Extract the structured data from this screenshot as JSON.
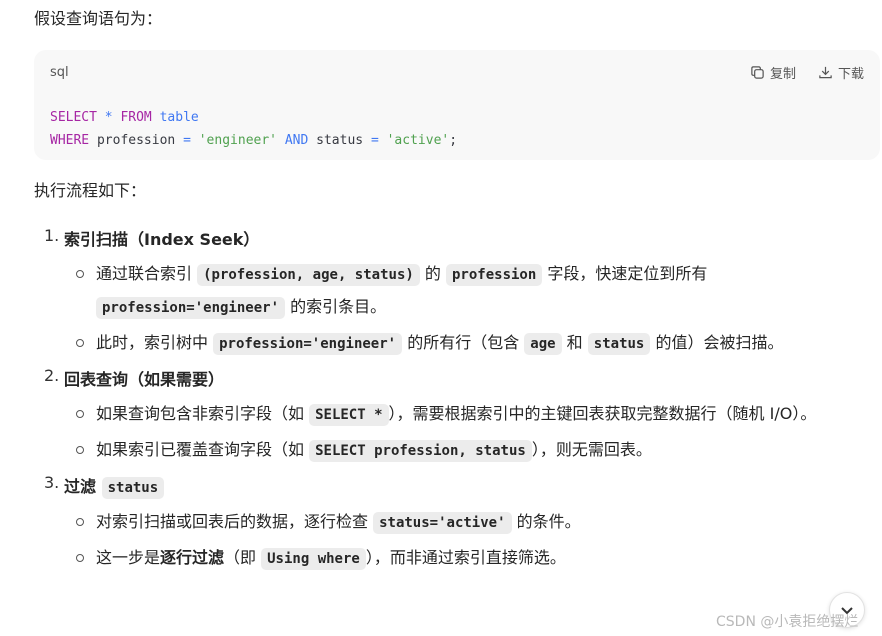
{
  "intro": "假设查询语句为：",
  "code_block": {
    "lang": "sql",
    "copy_label": "复制",
    "download_label": "下载",
    "line1": {
      "kw1": "SELECT",
      "op": "*",
      "kw2": "FROM",
      "tbl": "table"
    },
    "line2": {
      "kw1": "WHERE",
      "col1": "profession",
      "eq1": "=",
      "v1": "'engineer'",
      "kw2": "AND",
      "col2": "status",
      "eq2": "=",
      "v2": "'active'",
      "end": ";"
    }
  },
  "flow_title": "执行流程如下：",
  "steps": [
    {
      "num": "1.",
      "title": "索引扫描（Index Seek）",
      "items": [
        {
          "t1": "通过联合索引 ",
          "c1": "(profession, age, status)",
          "t2": " 的 ",
          "c2": "profession",
          "t3": " 字段，快速定位到所有 ",
          "c3": "profession='engineer'",
          "t4": " 的索引条目。"
        },
        {
          "t1": "此时，索引树中 ",
          "c1": "profession='engineer'",
          "t2": " 的所有行（包含 ",
          "c2": "age",
          "t3": " 和 ",
          "c3": "status",
          "t4": " 的值）会被扫描。"
        }
      ]
    },
    {
      "num": "2.",
      "title": "回表查询（如果需要）",
      "items": [
        {
          "t1": "如果查询包含非索引字段（如 ",
          "c1": "SELECT *",
          "t2": "），需要根据索引中的主键回表获取完整数据行（随机 I/O）。"
        },
        {
          "t1": "如果索引已覆盖查询字段（如 ",
          "c1": "SELECT profession, status",
          "t2": "），则无需回表。"
        }
      ]
    },
    {
      "num": "3.",
      "title": "过滤",
      "title_code": "status",
      "items": [
        {
          "t1": "对索引扫描或回表后的数据，逐行检查 ",
          "c1": "status='active'",
          "t2": " 的条件。"
        },
        {
          "t1": "这一步是",
          "b1": "逐行过滤",
          "t2": "（即 ",
          "c1": "Using where",
          "t3": "），而非通过索引直接筛选。"
        }
      ]
    }
  ],
  "scroll_button_icon": "chevron-down-icon",
  "watermark": "CSDN @小袁拒绝摆烂"
}
